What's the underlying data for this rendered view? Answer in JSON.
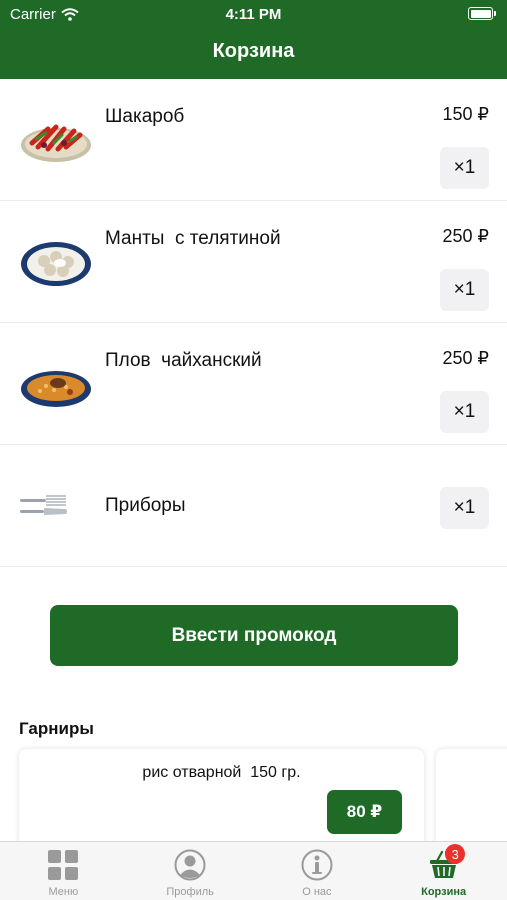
{
  "status": {
    "carrier": "Carrier",
    "time": "4:11 PM"
  },
  "header": {
    "title": "Корзина"
  },
  "cart": {
    "items": [
      {
        "name": "Шакароб",
        "price": "150 ₽",
        "qty": "×1",
        "icon": "salad-plate-icon"
      },
      {
        "name": "Манты  с телятиной",
        "price": "250 ₽",
        "qty": "×1",
        "icon": "dumplings-plate-icon"
      },
      {
        "name": "Плов  чайханский",
        "price": "250 ₽",
        "qty": "×1",
        "icon": "plov-plate-icon"
      }
    ],
    "cutlery": {
      "name": "Приборы",
      "qty": "×1",
      "icon": "cutlery-icon"
    }
  },
  "promo": {
    "label": "Ввести промокод"
  },
  "sides": {
    "title": "Гарниры",
    "items": [
      {
        "name": "рис отварной  150 гр.",
        "price": "80 ₽"
      }
    ]
  },
  "tabbar": {
    "tabs": [
      {
        "label": "Меню",
        "icon": "menu-grid-icon"
      },
      {
        "label": "Профиль",
        "icon": "profile-icon"
      },
      {
        "label": "О нас",
        "icon": "info-icon"
      },
      {
        "label": "Корзина",
        "icon": "basket-icon",
        "badge": "3",
        "active": true
      }
    ]
  },
  "colors": {
    "brand": "#1f6a27",
    "badge": "#e8322c",
    "qty_bg": "#f1f1f3",
    "tab_inactive": "#9a9a9a"
  }
}
